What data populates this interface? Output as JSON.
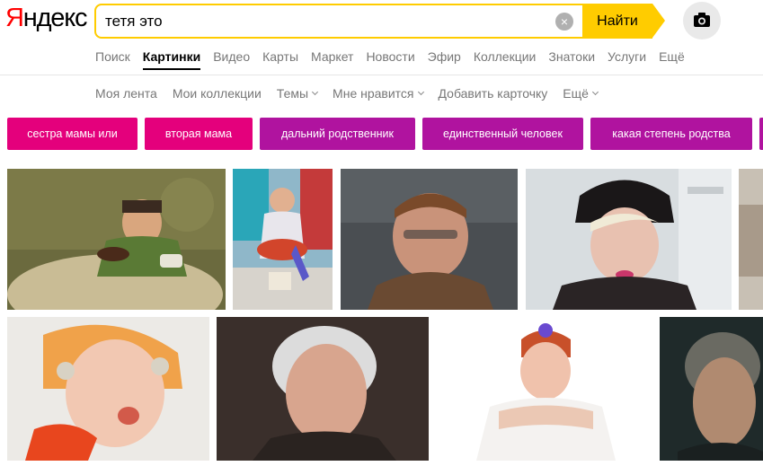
{
  "header": {
    "logo_first": "Я",
    "logo_rest": "ндекс",
    "search_value": "тетя это",
    "clear_label": "×",
    "find_label": "Найти"
  },
  "tabs": [
    "Поиск",
    "Картинки",
    "Видео",
    "Карты",
    "Маркет",
    "Новости",
    "Эфир",
    "Коллекции",
    "Знатоки",
    "Услуги",
    "Ещё"
  ],
  "active_tab": "Картинки",
  "subnav": [
    {
      "label": "Моя лента",
      "dropdown": false
    },
    {
      "label": "Мои коллекции",
      "dropdown": false
    },
    {
      "label": "Темы",
      "dropdown": true
    },
    {
      "label": "Мне нравится",
      "dropdown": true
    },
    {
      "label": "Добавить карточку",
      "dropdown": false
    },
    {
      "label": "Ещё",
      "dropdown": true
    }
  ],
  "chips": [
    {
      "label": "сестра мамы или",
      "color": "#e4007c"
    },
    {
      "label": "вторая мама",
      "color": "#e4007c"
    },
    {
      "label": "дальний родственник",
      "color": "#b0139f"
    },
    {
      "label": "единственный человек",
      "color": "#b0139f"
    },
    {
      "label": "какая степень родства",
      "color": "#b0139f"
    }
  ],
  "colors": {
    "accent": "#ffcc00",
    "logo_red": "#ff0000",
    "chip_pink": "#e4007c",
    "chip_purple": "#b0139f"
  }
}
